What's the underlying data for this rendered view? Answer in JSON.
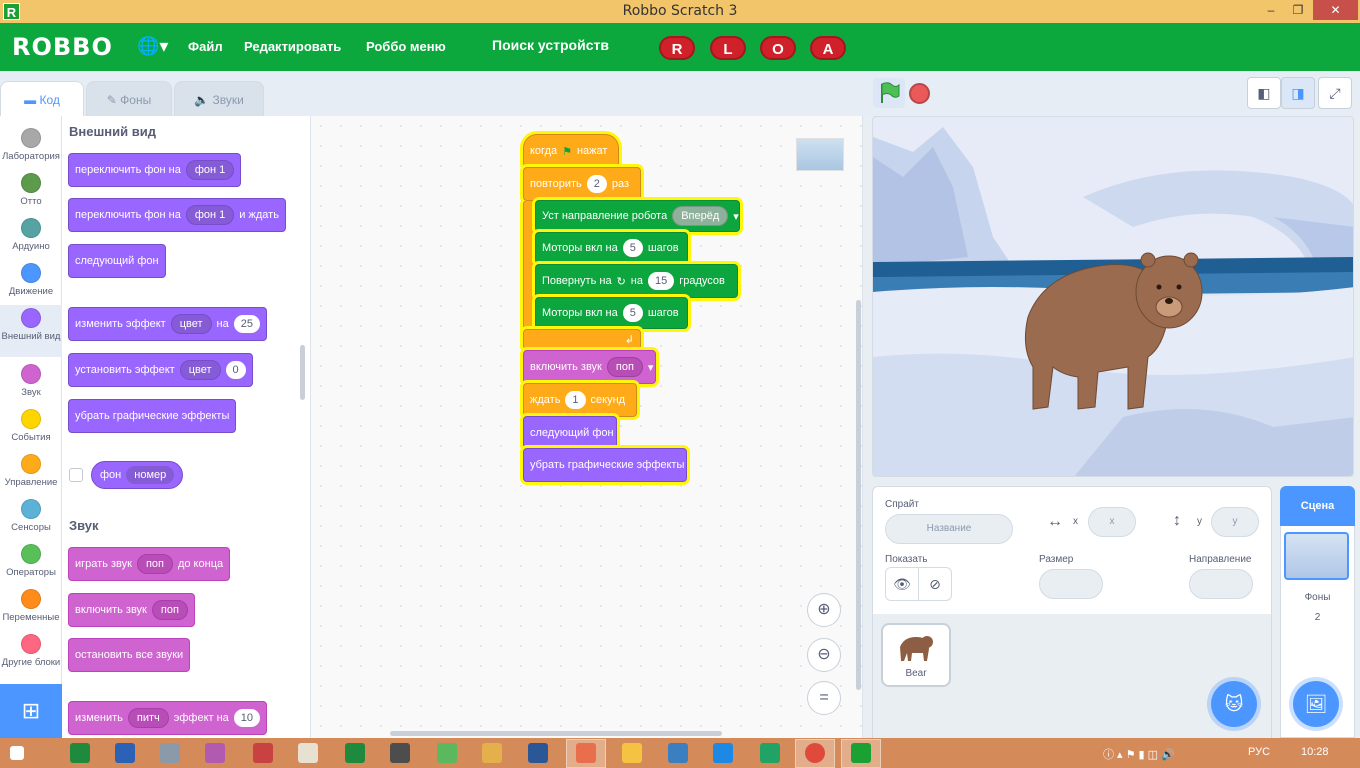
{
  "window": {
    "title": "Robbo Scratch 3",
    "app_icon_letter": "R",
    "minimize": "–",
    "restore": "❐",
    "close": "✕"
  },
  "menubar": {
    "logo": "ROBBO",
    "items": [
      "Файл",
      "Редактировать",
      "Роббо меню"
    ],
    "search_devices": "Поиск устройств",
    "pills": [
      "R",
      "L",
      "O",
      "A"
    ]
  },
  "tabs": [
    "Код",
    "Фоны",
    "Звуки"
  ],
  "categories": [
    {
      "label": "Лаборатория",
      "color": "#a8a8a8"
    },
    {
      "label": "Отто",
      "color": "#5c9a4c"
    },
    {
      "label": "Ардуино",
      "color": "#55a3a3"
    },
    {
      "label": "Движение",
      "color": "#4c97ff"
    },
    {
      "label": "Внешний вид",
      "color": "#9966ff"
    },
    {
      "label": "Звук",
      "color": "#cf63cf"
    },
    {
      "label": "События",
      "color": "#ffd500"
    },
    {
      "label": "Управление",
      "color": "#ffab19"
    },
    {
      "label": "Сенсоры",
      "color": "#5cb1d6"
    },
    {
      "label": "Операторы",
      "color": "#59c059"
    },
    {
      "label": "Переменные",
      "color": "#ff8c1a"
    },
    {
      "label": "Другие блоки",
      "color": "#ff6680"
    }
  ],
  "palette": {
    "looks_title": "Внешний вид",
    "b1": {
      "text": "переключить фон на",
      "dd": "фон 1"
    },
    "b2": {
      "text": "переключить фон на",
      "dd": "фон 1",
      "suffix": "и ждать"
    },
    "b3": {
      "text": "следующий фон"
    },
    "b4": {
      "text": "изменить эффект",
      "dd": "цвет",
      "mid": "на",
      "num": "25"
    },
    "b5": {
      "text": "установить эффект",
      "dd": "цвет",
      "num": "0"
    },
    "b6": {
      "text": "убрать графические эффекты"
    },
    "b7": {
      "text": "фон",
      "dd": "номер"
    },
    "sound_title": "Звук",
    "s1": {
      "text": "играть звук",
      "dd": "поп",
      "suffix": "до конца"
    },
    "s2": {
      "text": "включить звук",
      "dd": "поп"
    },
    "s3": {
      "text": "остановить все звуки"
    },
    "s4": {
      "text": "изменить",
      "dd": "питч",
      "mid": "эффект на",
      "num": "10"
    }
  },
  "script": {
    "hat": {
      "text": "когда",
      "suffix": "нажат"
    },
    "repeat": {
      "text": "повторить",
      "num": "2",
      "suffix": "раз"
    },
    "dir": {
      "text": "Уст направление робота",
      "dd": "Вперёд"
    },
    "motors1": {
      "text": "Моторы вкл на",
      "num": "5",
      "suffix": "шагов"
    },
    "turn": {
      "text": "Повернуть на",
      "mid": "на",
      "num": "15",
      "suffix": "градусов"
    },
    "motors2": {
      "text": "Моторы вкл на",
      "num": "5",
      "suffix": "шагов"
    },
    "sound": {
      "text": "включить звук",
      "dd": "поп"
    },
    "wait": {
      "text": "ждать",
      "num": "1",
      "suffix": "секунд"
    },
    "next": {
      "text": "следующий фон"
    },
    "clear": {
      "text": "убрать графические эффекты"
    }
  },
  "sprite_info": {
    "sprite_label": "Спрайт",
    "name_placeholder": "Название",
    "x_label": "x",
    "x_placeholder": "x",
    "y_label": "y",
    "y_placeholder": "y",
    "show_label": "Показать",
    "size_label": "Размер",
    "direction_label": "Направление"
  },
  "sprites": [
    {
      "name": "Bear"
    }
  ],
  "scene": {
    "title": "Сцена",
    "backdrops_label": "Фоны",
    "backdrops_count": "2"
  },
  "taskbar": {
    "lang": "РУС",
    "time": "10:28"
  }
}
